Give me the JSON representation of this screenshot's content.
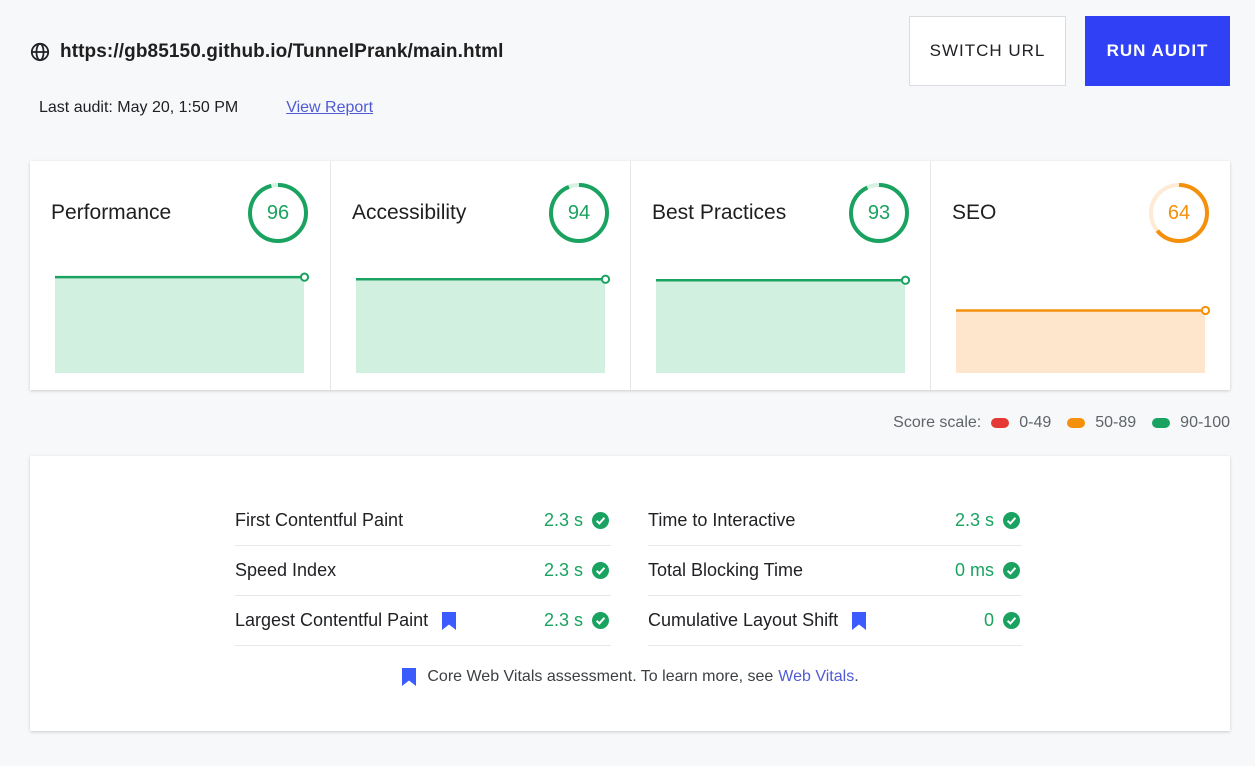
{
  "header": {
    "globe_icon": "globe-icon",
    "url": "https://gb85150.github.io/TunnelPrank/main.html",
    "last_audit": "Last audit: May 20, 1:50 PM",
    "view_report": "View Report",
    "switch_url": "SWITCH URL",
    "run_audit": "RUN AUDIT"
  },
  "colors": {
    "pass": "#1aa260",
    "average": "#f4900c",
    "fail": "#e53935",
    "accent": "#3040f5"
  },
  "scores": [
    {
      "title": "Performance",
      "score": "96",
      "value": 96,
      "status": "pass"
    },
    {
      "title": "Accessibility",
      "score": "94",
      "value": 94,
      "status": "pass"
    },
    {
      "title": "Best Practices",
      "score": "93",
      "value": 93,
      "status": "pass"
    },
    {
      "title": "SEO",
      "score": "64",
      "value": 64,
      "status": "average"
    }
  ],
  "scale": {
    "label": "Score scale:",
    "ranges": [
      "0-49",
      "50-89",
      "90-100"
    ]
  },
  "metrics": {
    "left": [
      {
        "name": "First Contentful Paint",
        "value": "2.3 s",
        "core": false
      },
      {
        "name": "Speed Index",
        "value": "2.3 s",
        "core": false
      },
      {
        "name": "Largest Contentful Paint",
        "value": "2.3 s",
        "core": true
      }
    ],
    "right": [
      {
        "name": "Time to Interactive",
        "value": "2.3 s",
        "core": false
      },
      {
        "name": "Total Blocking Time",
        "value": "0 ms",
        "core": false
      },
      {
        "name": "Cumulative Layout Shift",
        "value": "0",
        "core": true
      }
    ],
    "footer_text": "Core Web Vitals assessment. To learn more, see",
    "footer_link": "Web Vitals",
    "footer_end": "."
  }
}
